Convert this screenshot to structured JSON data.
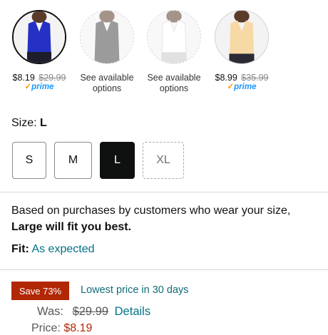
{
  "swatches": [
    {
      "price": "$8.19",
      "old_price": "$29.99",
      "prime": "prime",
      "color": "#2431c4",
      "state": "selected"
    },
    {
      "line1": "See available",
      "line2": "options",
      "color": "#4a4a4a",
      "state": "unavailable"
    },
    {
      "line1": "See available",
      "line2": "options",
      "color": "#f2f2f2",
      "state": "unavailable"
    },
    {
      "price": "$8.99",
      "old_price": "$35.99",
      "prime": "prime",
      "color": "#f7d9a6",
      "state": "available"
    }
  ],
  "size": {
    "label": "Size:",
    "selected": "L",
    "options": [
      "S",
      "M",
      "L",
      "XL"
    ]
  },
  "fit": {
    "intro": "Based on purchases by customers who wear your size,",
    "recommendation": "Large will fit you best.",
    "label": "Fit:",
    "value": "As expected"
  },
  "pricing": {
    "badge": "Save 73%",
    "lowest": "Lowest price in 30 days",
    "was_label": "Was:",
    "was_price": "$29.99",
    "details": "Details",
    "price_label": "Price:",
    "price_value": "$8.19"
  },
  "colors": {
    "accent_link": "#007185",
    "deal_red": "#b12704",
    "prime_blue": "#1a98ff"
  }
}
